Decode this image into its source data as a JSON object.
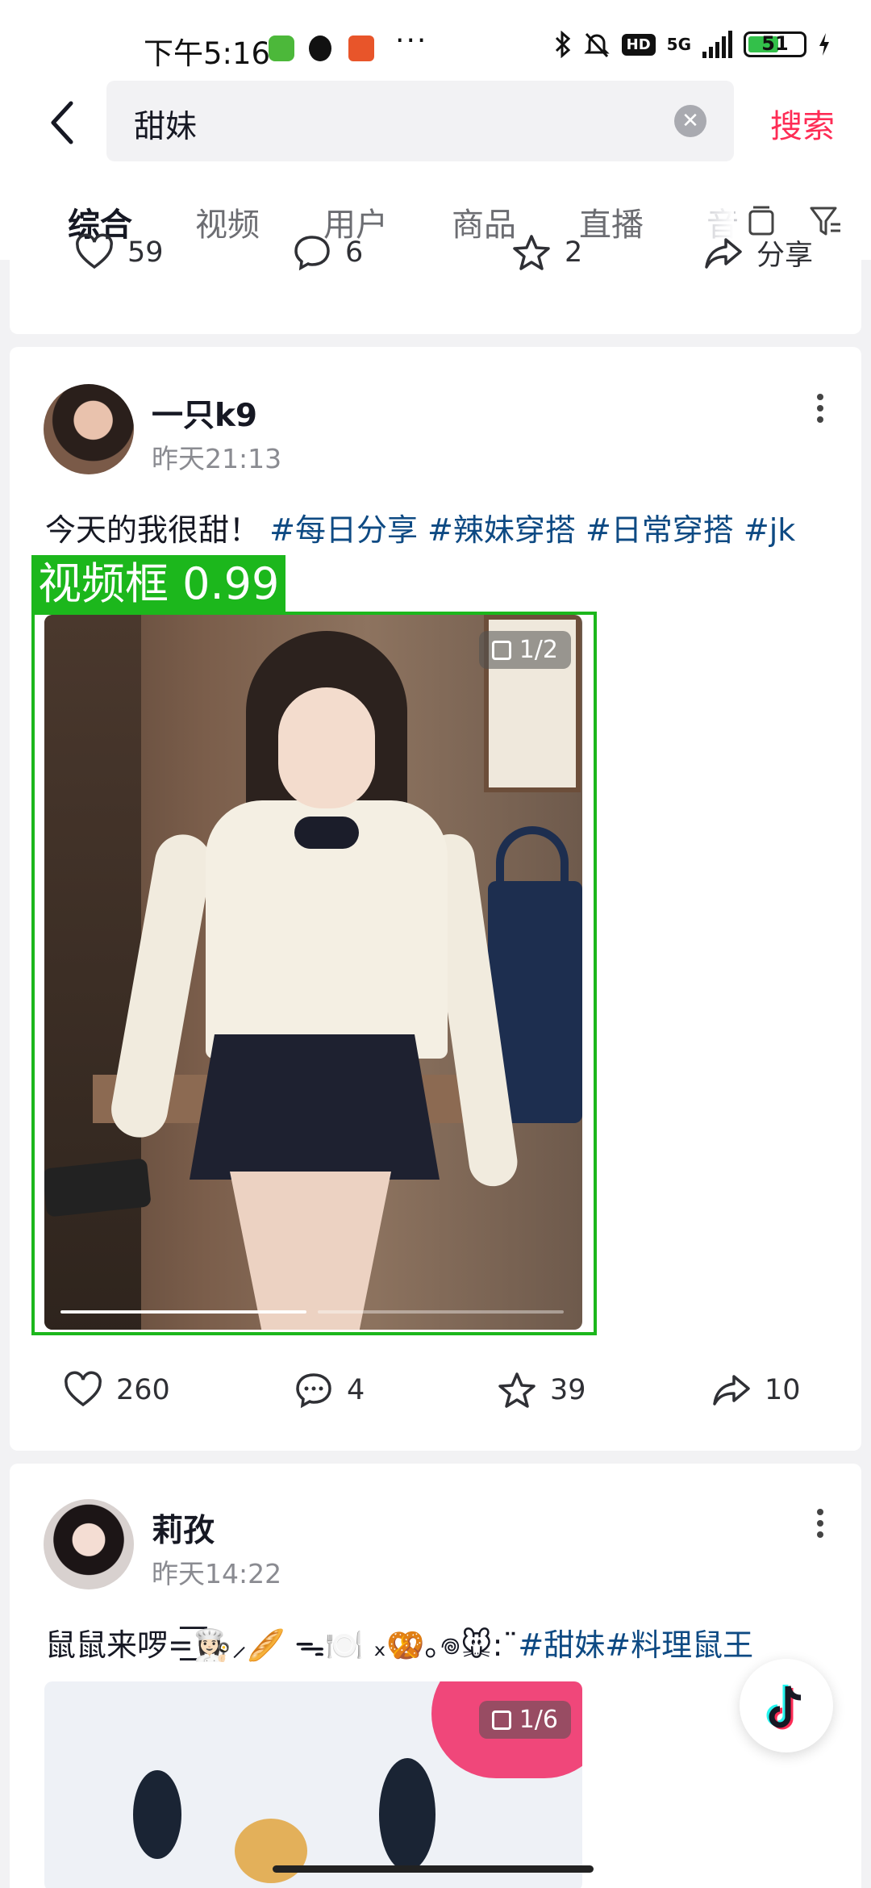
{
  "status_bar": {
    "time": "下午5:16",
    "network": "5G",
    "battery": "51",
    "more_glyph": "···",
    "icons": [
      "app-icon",
      "qq-icon",
      "58-icon",
      "bluetooth-icon",
      "mute-icon",
      "hd-icon",
      "signal-icon",
      "battery-icon",
      "charging-icon"
    ]
  },
  "search": {
    "query": "甜妹",
    "clear_glyph": "✕",
    "submit_label": "搜索"
  },
  "tabs": [
    {
      "label": "综合",
      "active": true
    },
    {
      "label": "视频",
      "active": false
    },
    {
      "label": "用户",
      "active": false
    },
    {
      "label": "商品",
      "active": false
    },
    {
      "label": "直播",
      "active": false
    },
    {
      "label": "音",
      "active": false
    }
  ],
  "previous_post": {
    "likes": "59",
    "comments": "6",
    "favorites": "2",
    "share_label": "分享"
  },
  "post": {
    "author": "一只k9",
    "time": "昨天21:13",
    "text": "今天的我很甜！",
    "tags": "#每日分享 #辣妹穿搭 #日常穿搭 #jk",
    "image_counter": "1/2",
    "image_slides": 2,
    "current_slide": 1,
    "likes": "260",
    "comments": "4",
    "favorites": "39",
    "shares": "10",
    "detection": {
      "label": "视频框 0.99",
      "color": "#1cb71c"
    }
  },
  "next_post": {
    "author": "莉孜",
    "time": "昨天14:22",
    "text": "鼠鼠来啰=͟͟͞͞👩🏻‍🍳⸝🥖 ᯓ🍽️ ₓ🥨｡𖦹🐭:¨",
    "tags": "#甜妹#料理鼠王",
    "image_counter": "1/6"
  },
  "colors": {
    "accent": "#fe2c55",
    "tag": "#0e4a83",
    "muted": "#8a8b91"
  }
}
